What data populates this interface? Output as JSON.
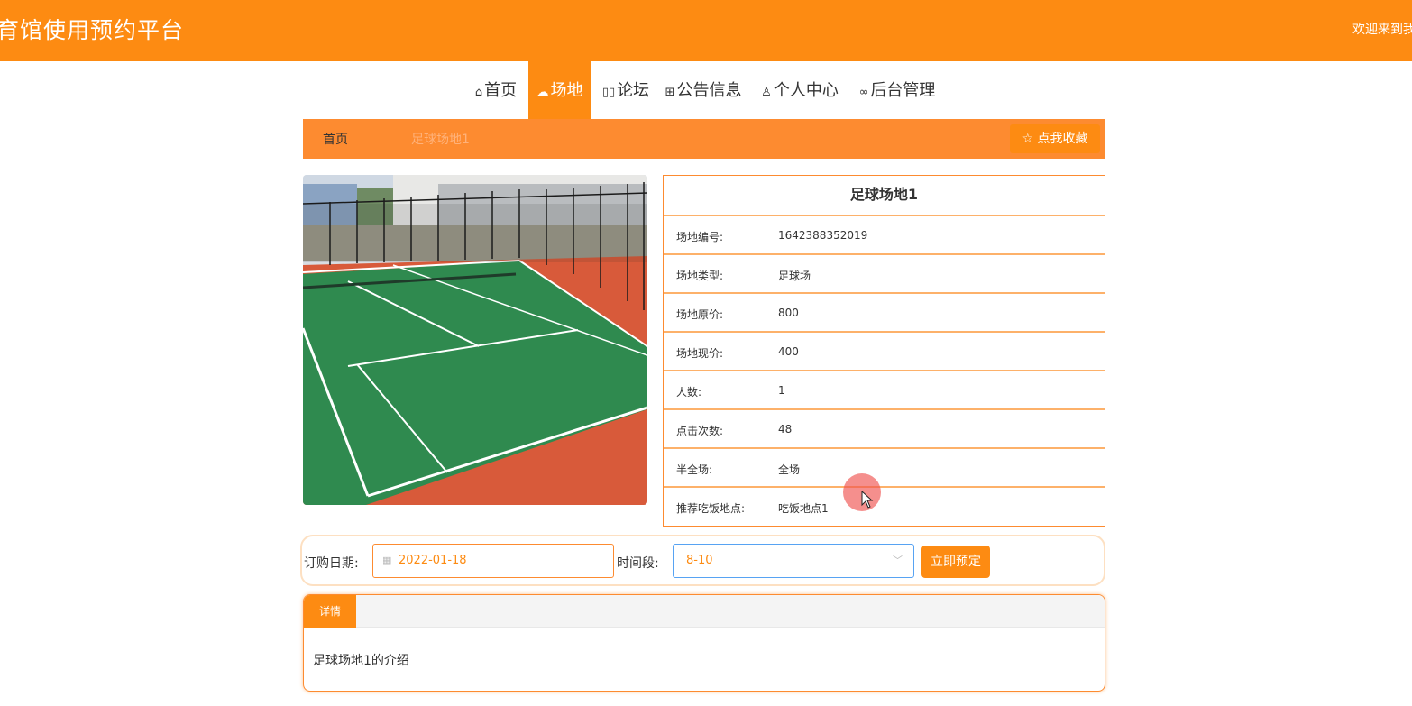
{
  "header": {
    "site_title": "育馆使用预约平台",
    "welcome_text": "欢迎来到我"
  },
  "nav": {
    "items": [
      {
        "icon": "home-icon",
        "glyph": "⌂",
        "label": "首页"
      },
      {
        "icon": "cloud-icon",
        "glyph": "☁",
        "label": "场地"
      },
      {
        "icon": "forum-icon",
        "glyph": "▯▯",
        "label": "论坛"
      },
      {
        "icon": "gift-icon",
        "glyph": "⊞",
        "label": "公告信息"
      },
      {
        "icon": "user-icon",
        "glyph": "♙",
        "label": "个人中心"
      },
      {
        "icon": "link-icon",
        "glyph": "∞",
        "label": "后台管理"
      }
    ],
    "active_index": 1
  },
  "breadcrumb": {
    "home": "首页",
    "current": "足球场地1",
    "favorite_label": "☆ 点我收藏"
  },
  "venue": {
    "name": "足球场地1",
    "fields": [
      {
        "label": "场地编号:",
        "value": "1642388352019"
      },
      {
        "label": "场地类型:",
        "value": "足球场"
      },
      {
        "label": "场地原价:",
        "value": "800"
      },
      {
        "label": "场地现价:",
        "value": "400"
      },
      {
        "label": "人数:",
        "value": "1"
      },
      {
        "label": "点击次数:",
        "value": "48"
      },
      {
        "label": "半全场:",
        "value": "全场"
      },
      {
        "label": "推荐吃饭地点:",
        "value": "吃饭地点1"
      }
    ]
  },
  "order": {
    "date_label": "订购日期:",
    "date_value": "2022-01-18",
    "time_label": "时间段:",
    "time_value": "8-10",
    "book_label": "立即预定"
  },
  "detail": {
    "tab_label": "详情",
    "content": "足球场地1的介绍"
  },
  "colors": {
    "accent": "#fd8b12",
    "court_green": "#2f8a4f",
    "court_red": "#d85a3a"
  }
}
